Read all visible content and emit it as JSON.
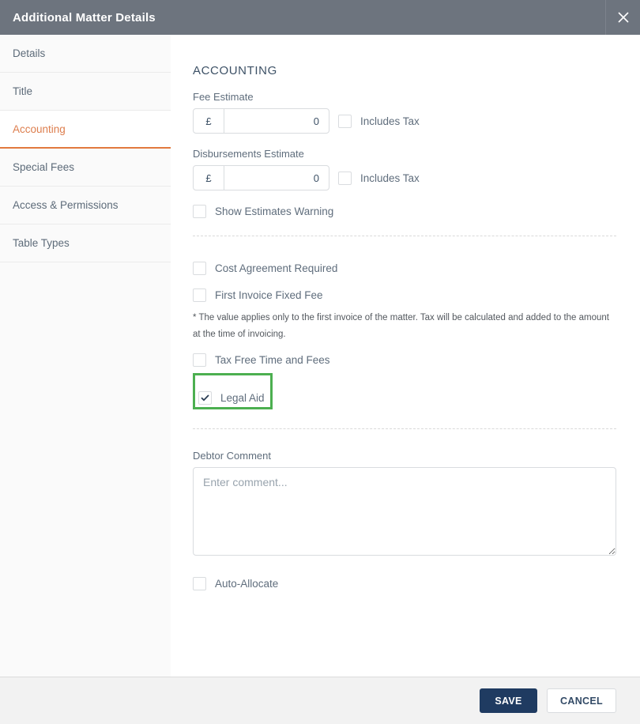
{
  "header": {
    "title": "Additional Matter Details",
    "close_icon": "x-close"
  },
  "sidebar": {
    "items": [
      {
        "label": "Details",
        "active": false
      },
      {
        "label": "Title",
        "active": false
      },
      {
        "label": "Accounting",
        "active": true
      },
      {
        "label": "Special Fees",
        "active": false
      },
      {
        "label": "Access & Permissions",
        "active": false
      },
      {
        "label": "Table Types",
        "active": false
      }
    ]
  },
  "content": {
    "section_title": "ACCOUNTING",
    "fee_estimate": {
      "label": "Fee Estimate",
      "currency": "£",
      "value": "0",
      "includes_tax_label": "Includes Tax",
      "includes_tax_checked": false
    },
    "disbursements_estimate": {
      "label": "Disbursements Estimate",
      "currency": "£",
      "value": "0",
      "includes_tax_label": "Includes Tax",
      "includes_tax_checked": false
    },
    "show_estimates_warning": {
      "label": "Show Estimates Warning",
      "checked": false
    },
    "cost_agreement_required": {
      "label": "Cost Agreement Required",
      "checked": false
    },
    "first_invoice_fixed_fee": {
      "label": "First Invoice Fixed Fee",
      "checked": false
    },
    "footnote": "* The value applies only to the first invoice of the matter. Tax will be calculated and added to the amount at the time of invoicing.",
    "tax_free_time_and_fees": {
      "label": "Tax Free Time and Fees",
      "checked": false
    },
    "legal_aid": {
      "label": "Legal Aid",
      "checked": true,
      "highlighted": true,
      "highlight_color": "#4caf50"
    },
    "debtor_comment": {
      "label": "Debtor Comment",
      "placeholder": "Enter comment...",
      "value": ""
    },
    "auto_allocate": {
      "label": "Auto-Allocate",
      "checked": false
    }
  },
  "footer": {
    "save_label": "SAVE",
    "cancel_label": "CANCEL"
  },
  "colors": {
    "header_bg": "#6d747e",
    "accent_orange": "#e2793e",
    "active_tab_text": "#dd7e4e",
    "heading_navy": "#3d5166",
    "save_button_bg": "#1f3b61",
    "highlight_green": "#4caf50",
    "footer_bg": "#f2f2f2",
    "sidebar_bg": "#fafafa"
  }
}
